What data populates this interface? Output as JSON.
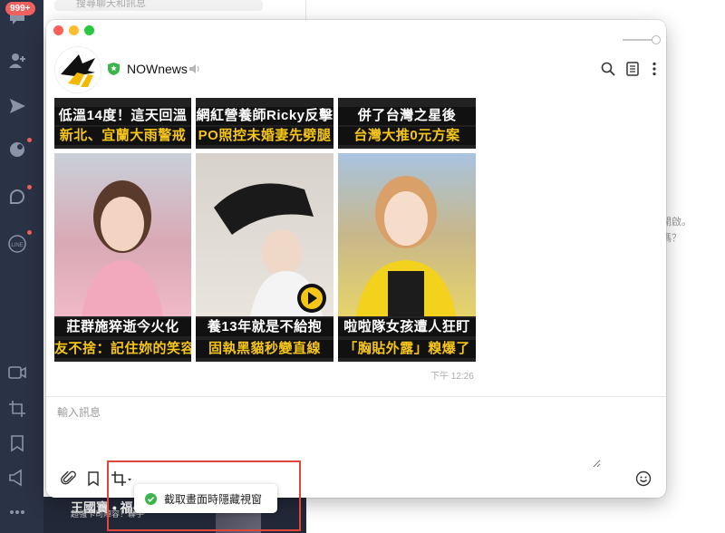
{
  "background": {
    "sidebar": {
      "badge": "999+",
      "icons": [
        "chat-icon",
        "add-friend-icon",
        "send-icon",
        "openchat-icon",
        "square-icon",
        "line-icon",
        "video-icon",
        "crop-icon",
        "bookmark-icon",
        "megaphone-icon",
        "more-icon"
      ]
    },
    "search_placeholder": "搜尋聊天和訊息",
    "bottom_banner": {
      "title": "王國寶 • 福盛",
      "subtitle": "超強卡司陣容！聯手"
    },
    "right_text_line1": "開啟。",
    "right_text_line2": "嗎？"
  },
  "chat": {
    "name": "NOWnews",
    "header_icons": [
      "search-icon",
      "notes-icon",
      "more-icon"
    ],
    "cards": [
      {
        "caption1": "低溫14度！這天回溫",
        "caption2": "新北、宜蘭大雨警戒"
      },
      {
        "caption1": "網紅營養師Ricky反擊",
        "caption2": "PO照控未婚妻先劈腿"
      },
      {
        "caption1": "併了台灣之星後",
        "caption2": "台灣大推0元方案"
      },
      {
        "caption1": "莊群施猝逝今火化",
        "caption2": "友不捨：記住妳的笑容"
      },
      {
        "caption1": "養13年就是不給抱",
        "caption2": "固執黑貓秒變直線"
      },
      {
        "caption1": "啦啦隊女孩遭人狂盯",
        "caption2": "「胸貼外露」糗爆了"
      }
    ],
    "timestamp": "下午 12:26",
    "input_placeholder": "輸入訊息",
    "tooltip": "截取畫面時隱藏視窗",
    "colors": {
      "caption_yellow": "#f5c518",
      "highlight": "#e2463a",
      "verified": "#3bb54a"
    }
  }
}
